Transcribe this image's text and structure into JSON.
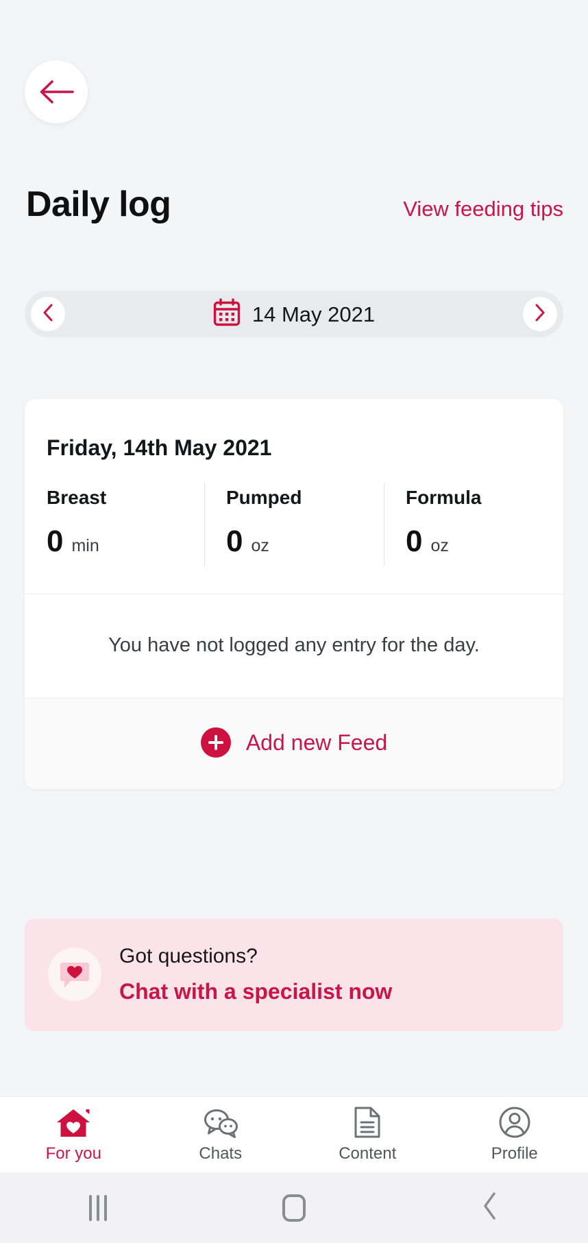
{
  "colors": {
    "accent": "#C9154A",
    "accent_solid": "#CE123F",
    "page_background": "#F4F5F7",
    "card_background": "#FFFFFF",
    "banner_background": "#FAE3E9",
    "muted_text": "#53555C"
  },
  "nav": {
    "back_icon": "arrow-left-icon"
  },
  "header": {
    "title": "Daily log",
    "tips_link": "View feeding tips"
  },
  "date_selector": {
    "prev_icon": "chevron-left-icon",
    "next_icon": "chevron-right-icon",
    "calendar_icon": "calendar-icon",
    "date": "14 May 2021"
  },
  "log_card": {
    "date_heading": "Friday, 14th May 2021",
    "stats": [
      {
        "label": "Breast",
        "value": "0",
        "unit": "min"
      },
      {
        "label": "Pumped",
        "value": "0",
        "unit": "oz"
      },
      {
        "label": "Formula",
        "value": "0",
        "unit": "oz"
      }
    ],
    "empty_message": "You have not logged any entry for the day.",
    "add_feed": {
      "label": "Add new Feed",
      "icon": "plus-circle-icon"
    }
  },
  "chat_banner": {
    "icon": "chat-heart-icon",
    "question": "Got questions?",
    "cta": "Chat with a specialist now"
  },
  "tabbar": {
    "items": [
      {
        "label": "For you",
        "icon": "home-heart-icon",
        "active": true
      },
      {
        "label": "Chats",
        "icon": "chat-bubbles-icon",
        "active": false
      },
      {
        "label": "Content",
        "icon": "document-icon",
        "active": false
      },
      {
        "label": "Profile",
        "icon": "user-circle-icon",
        "active": false
      }
    ]
  },
  "system_bar": {
    "recents": "recents-icon",
    "home": "home-square-icon",
    "back": "back-chevron-icon"
  }
}
